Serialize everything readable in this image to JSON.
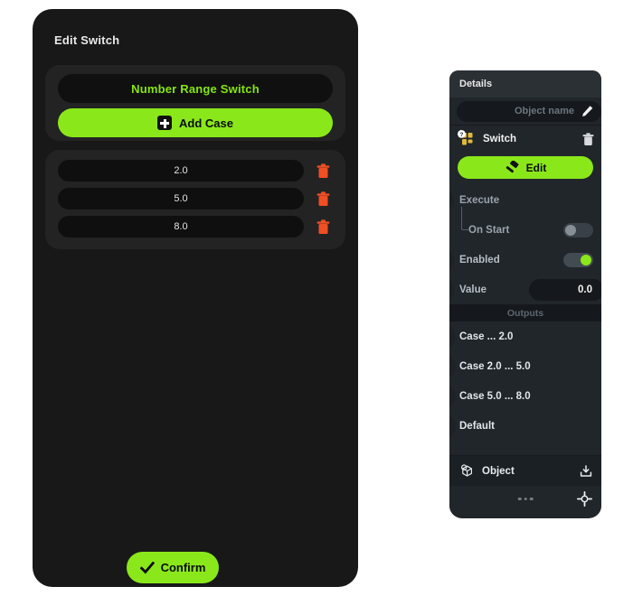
{
  "edit_dialog": {
    "title": "Edit Switch",
    "switch_name": "Number Range Switch",
    "add_case_label": "Add Case",
    "add_case_icon": "plus-icon",
    "cases": [
      {
        "value": "2.0",
        "delete_icon": "trash-icon"
      },
      {
        "value": "5.0",
        "delete_icon": "trash-icon"
      },
      {
        "value": "8.0",
        "delete_icon": "trash-icon"
      }
    ],
    "confirm_label": "Confirm",
    "confirm_icon": "check-icon"
  },
  "details_panel": {
    "title": "Details",
    "object_name_placeholder": "Object name",
    "object_name_value": "",
    "edit_name_icon": "pencil-icon",
    "node": {
      "type_icon": "puzzle-piece-icon",
      "help_badge_icon": "question-mark-icon",
      "name": "Switch",
      "delete_icon": "trash-icon"
    },
    "edit_button": {
      "label": "Edit",
      "icon": "hammer-icon"
    },
    "execute": {
      "label": "Execute",
      "port_icon": "input-port-icon",
      "on_start": {
        "label": "On Start",
        "toggle_state": "off"
      }
    },
    "enabled": {
      "label": "Enabled",
      "toggle_state": "on",
      "port_icon": "input-port-icon"
    },
    "value": {
      "label": "Value",
      "value": "0.0",
      "port_icon": "input-port-icon"
    },
    "outputs_header": "Outputs",
    "outputs": [
      {
        "label": "Case ... 2.0",
        "port_icon": "output-port-icon"
      },
      {
        "label": "Case 2.0 ... 5.0",
        "port_icon": "output-port-icon"
      },
      {
        "label": "Case 5.0 ... 8.0",
        "port_icon": "output-port-icon"
      },
      {
        "label": "Default",
        "port_icon": "output-port-icon"
      }
    ],
    "object_row": {
      "label": "Object",
      "icon": "cube-icon",
      "action_icon": "insert-icon"
    },
    "footer": {
      "more_icon": "ellipsis-icon",
      "focus_icon": "crosshair-icon"
    }
  },
  "colors": {
    "accent_green": "#8ae81a",
    "delete_orange": "#f04e23",
    "panel_dark": "#181818",
    "details_bg": "#21262b",
    "puzzle_yellow": "#e2b93b"
  }
}
